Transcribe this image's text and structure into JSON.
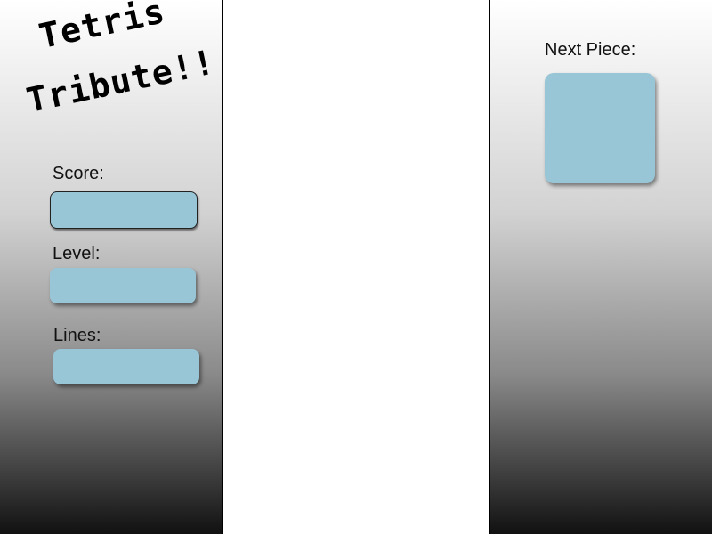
{
  "title": {
    "line1": "Tetris",
    "line2": "Tribute!!"
  },
  "stats": {
    "score_label": "Score:",
    "score_value": "",
    "level_label": "Level:",
    "level_value": "",
    "lines_label": "Lines:",
    "lines_value": ""
  },
  "next_piece": {
    "label": "Next Piece:"
  },
  "colors": {
    "panel_box": "#98c6d6",
    "gradient_top": "#ffffff",
    "gradient_bottom": "#111111"
  }
}
